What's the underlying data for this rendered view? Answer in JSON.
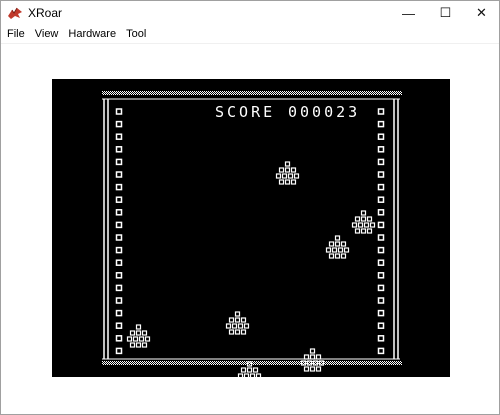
{
  "window": {
    "title": "XRoar",
    "icon": "xroar-dragon-icon",
    "controls": {
      "minimize": "—",
      "maximize": "☐",
      "close": "✕"
    }
  },
  "menu": {
    "items": [
      "File",
      "View",
      "Hardware",
      "Tool"
    ]
  },
  "game": {
    "score_label": "SCORE",
    "score_value": "000023",
    "colors": {
      "screen": "#000000",
      "fg": "#ffffff",
      "window_bg": "#ffffff"
    }
  }
}
